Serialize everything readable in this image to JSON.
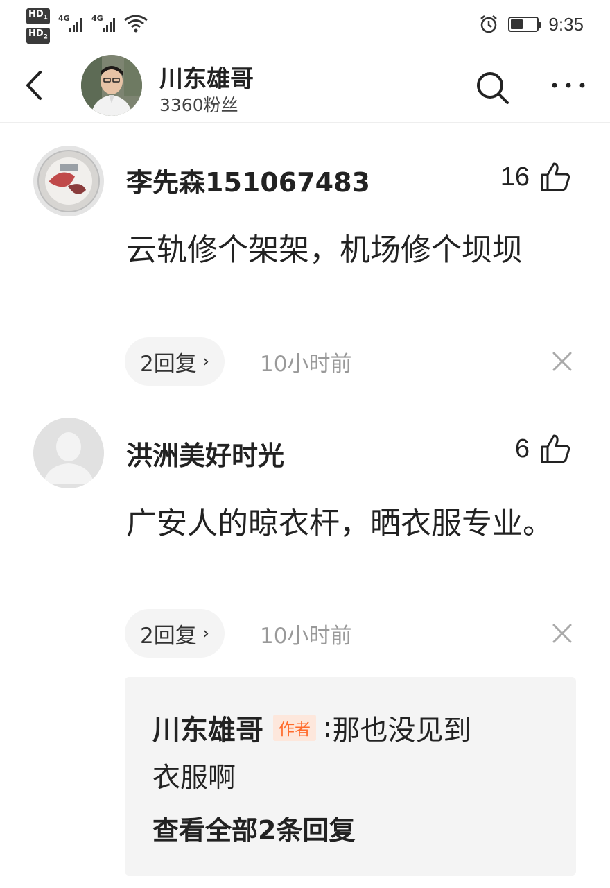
{
  "status_bar": {
    "time": "9:35",
    "sim1_label": "HD",
    "sim1_index": "1",
    "sim2_label": "HD",
    "sim2_index": "2",
    "network1": "4G",
    "network2": "4G",
    "battery_level": 0.45,
    "icons": [
      "alarm-icon",
      "battery-icon",
      "wifi-icon",
      "signal-icon"
    ]
  },
  "header": {
    "name": "川东雄哥",
    "fans": "3360粉丝",
    "icons": [
      "back-icon",
      "search-icon",
      "more-icon"
    ]
  },
  "comments": [
    {
      "username": "李先森151067483",
      "likes": "16",
      "text": "云轨修个架架，机场修个坝坝",
      "reply_label": "2回复",
      "time": "10小时前"
    },
    {
      "username": "洪洲美好时光",
      "likes": "6",
      "text": "广安人的晾衣杆，晒衣服专业。",
      "reply_label": "2回复",
      "time": "10小时前",
      "nested_reply": {
        "author": "川东雄哥",
        "badge": "作者",
        "colon": ":",
        "text_line1": "那也没见到",
        "text_line2": "衣服啊",
        "view_all": "查看全部2条回复"
      }
    }
  ],
  "colors": {
    "accent_badge_text": "#ff6b2c",
    "accent_badge_bg": "#fde7dc",
    "pill_bg": "#f4f4f4",
    "muted_text": "#999999"
  }
}
